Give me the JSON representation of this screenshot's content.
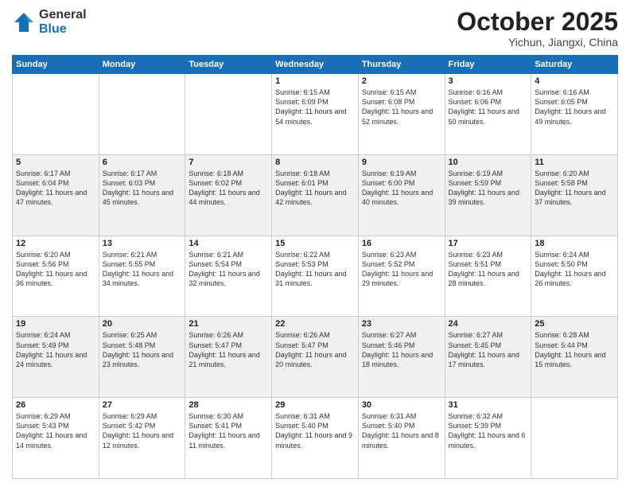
{
  "logo": {
    "general": "General",
    "blue": "Blue"
  },
  "header": {
    "month": "October 2025",
    "location": "Yichun, Jiangxi, China"
  },
  "days_of_week": [
    "Sunday",
    "Monday",
    "Tuesday",
    "Wednesday",
    "Thursday",
    "Friday",
    "Saturday"
  ],
  "weeks": [
    [
      {
        "day": "",
        "info": ""
      },
      {
        "day": "",
        "info": ""
      },
      {
        "day": "",
        "info": ""
      },
      {
        "day": "1",
        "info": "Sunrise: 6:15 AM\nSunset: 6:09 PM\nDaylight: 11 hours and 54 minutes."
      },
      {
        "day": "2",
        "info": "Sunrise: 6:15 AM\nSunset: 6:08 PM\nDaylight: 11 hours and 52 minutes."
      },
      {
        "day": "3",
        "info": "Sunrise: 6:16 AM\nSunset: 6:06 PM\nDaylight: 11 hours and 50 minutes."
      },
      {
        "day": "4",
        "info": "Sunrise: 6:16 AM\nSunset: 6:05 PM\nDaylight: 11 hours and 49 minutes."
      }
    ],
    [
      {
        "day": "5",
        "info": "Sunrise: 6:17 AM\nSunset: 6:04 PM\nDaylight: 11 hours and 47 minutes."
      },
      {
        "day": "6",
        "info": "Sunrise: 6:17 AM\nSunset: 6:03 PM\nDaylight: 11 hours and 45 minutes."
      },
      {
        "day": "7",
        "info": "Sunrise: 6:18 AM\nSunset: 6:02 PM\nDaylight: 11 hours and 44 minutes."
      },
      {
        "day": "8",
        "info": "Sunrise: 6:18 AM\nSunset: 6:01 PM\nDaylight: 11 hours and 42 minutes."
      },
      {
        "day": "9",
        "info": "Sunrise: 6:19 AM\nSunset: 6:00 PM\nDaylight: 11 hours and 40 minutes."
      },
      {
        "day": "10",
        "info": "Sunrise: 6:19 AM\nSunset: 5:59 PM\nDaylight: 11 hours and 39 minutes."
      },
      {
        "day": "11",
        "info": "Sunrise: 6:20 AM\nSunset: 5:58 PM\nDaylight: 11 hours and 37 minutes."
      }
    ],
    [
      {
        "day": "12",
        "info": "Sunrise: 6:20 AM\nSunset: 5:56 PM\nDaylight: 11 hours and 36 minutes."
      },
      {
        "day": "13",
        "info": "Sunrise: 6:21 AM\nSunset: 5:55 PM\nDaylight: 11 hours and 34 minutes."
      },
      {
        "day": "14",
        "info": "Sunrise: 6:21 AM\nSunset: 5:54 PM\nDaylight: 11 hours and 32 minutes."
      },
      {
        "day": "15",
        "info": "Sunrise: 6:22 AM\nSunset: 5:53 PM\nDaylight: 11 hours and 31 minutes."
      },
      {
        "day": "16",
        "info": "Sunrise: 6:23 AM\nSunset: 5:52 PM\nDaylight: 11 hours and 29 minutes."
      },
      {
        "day": "17",
        "info": "Sunrise: 6:23 AM\nSunset: 5:51 PM\nDaylight: 11 hours and 28 minutes."
      },
      {
        "day": "18",
        "info": "Sunrise: 6:24 AM\nSunset: 5:50 PM\nDaylight: 11 hours and 26 minutes."
      }
    ],
    [
      {
        "day": "19",
        "info": "Sunrise: 6:24 AM\nSunset: 5:49 PM\nDaylight: 11 hours and 24 minutes."
      },
      {
        "day": "20",
        "info": "Sunrise: 6:25 AM\nSunset: 5:48 PM\nDaylight: 11 hours and 23 minutes."
      },
      {
        "day": "21",
        "info": "Sunrise: 6:26 AM\nSunset: 5:47 PM\nDaylight: 11 hours and 21 minutes."
      },
      {
        "day": "22",
        "info": "Sunrise: 6:26 AM\nSunset: 5:47 PM\nDaylight: 11 hours and 20 minutes."
      },
      {
        "day": "23",
        "info": "Sunrise: 6:27 AM\nSunset: 5:46 PM\nDaylight: 11 hours and 18 minutes."
      },
      {
        "day": "24",
        "info": "Sunrise: 6:27 AM\nSunset: 5:45 PM\nDaylight: 11 hours and 17 minutes."
      },
      {
        "day": "25",
        "info": "Sunrise: 6:28 AM\nSunset: 5:44 PM\nDaylight: 11 hours and 15 minutes."
      }
    ],
    [
      {
        "day": "26",
        "info": "Sunrise: 6:29 AM\nSunset: 5:43 PM\nDaylight: 11 hours and 14 minutes."
      },
      {
        "day": "27",
        "info": "Sunrise: 6:29 AM\nSunset: 5:42 PM\nDaylight: 11 hours and 12 minutes."
      },
      {
        "day": "28",
        "info": "Sunrise: 6:30 AM\nSunset: 5:41 PM\nDaylight: 11 hours and 11 minutes."
      },
      {
        "day": "29",
        "info": "Sunrise: 6:31 AM\nSunset: 5:40 PM\nDaylight: 11 hours and 9 minutes."
      },
      {
        "day": "30",
        "info": "Sunrise: 6:31 AM\nSunset: 5:40 PM\nDaylight: 11 hours and 8 minutes."
      },
      {
        "day": "31",
        "info": "Sunrise: 6:32 AM\nSunset: 5:39 PM\nDaylight: 11 hours and 6 minutes."
      },
      {
        "day": "",
        "info": ""
      }
    ]
  ]
}
